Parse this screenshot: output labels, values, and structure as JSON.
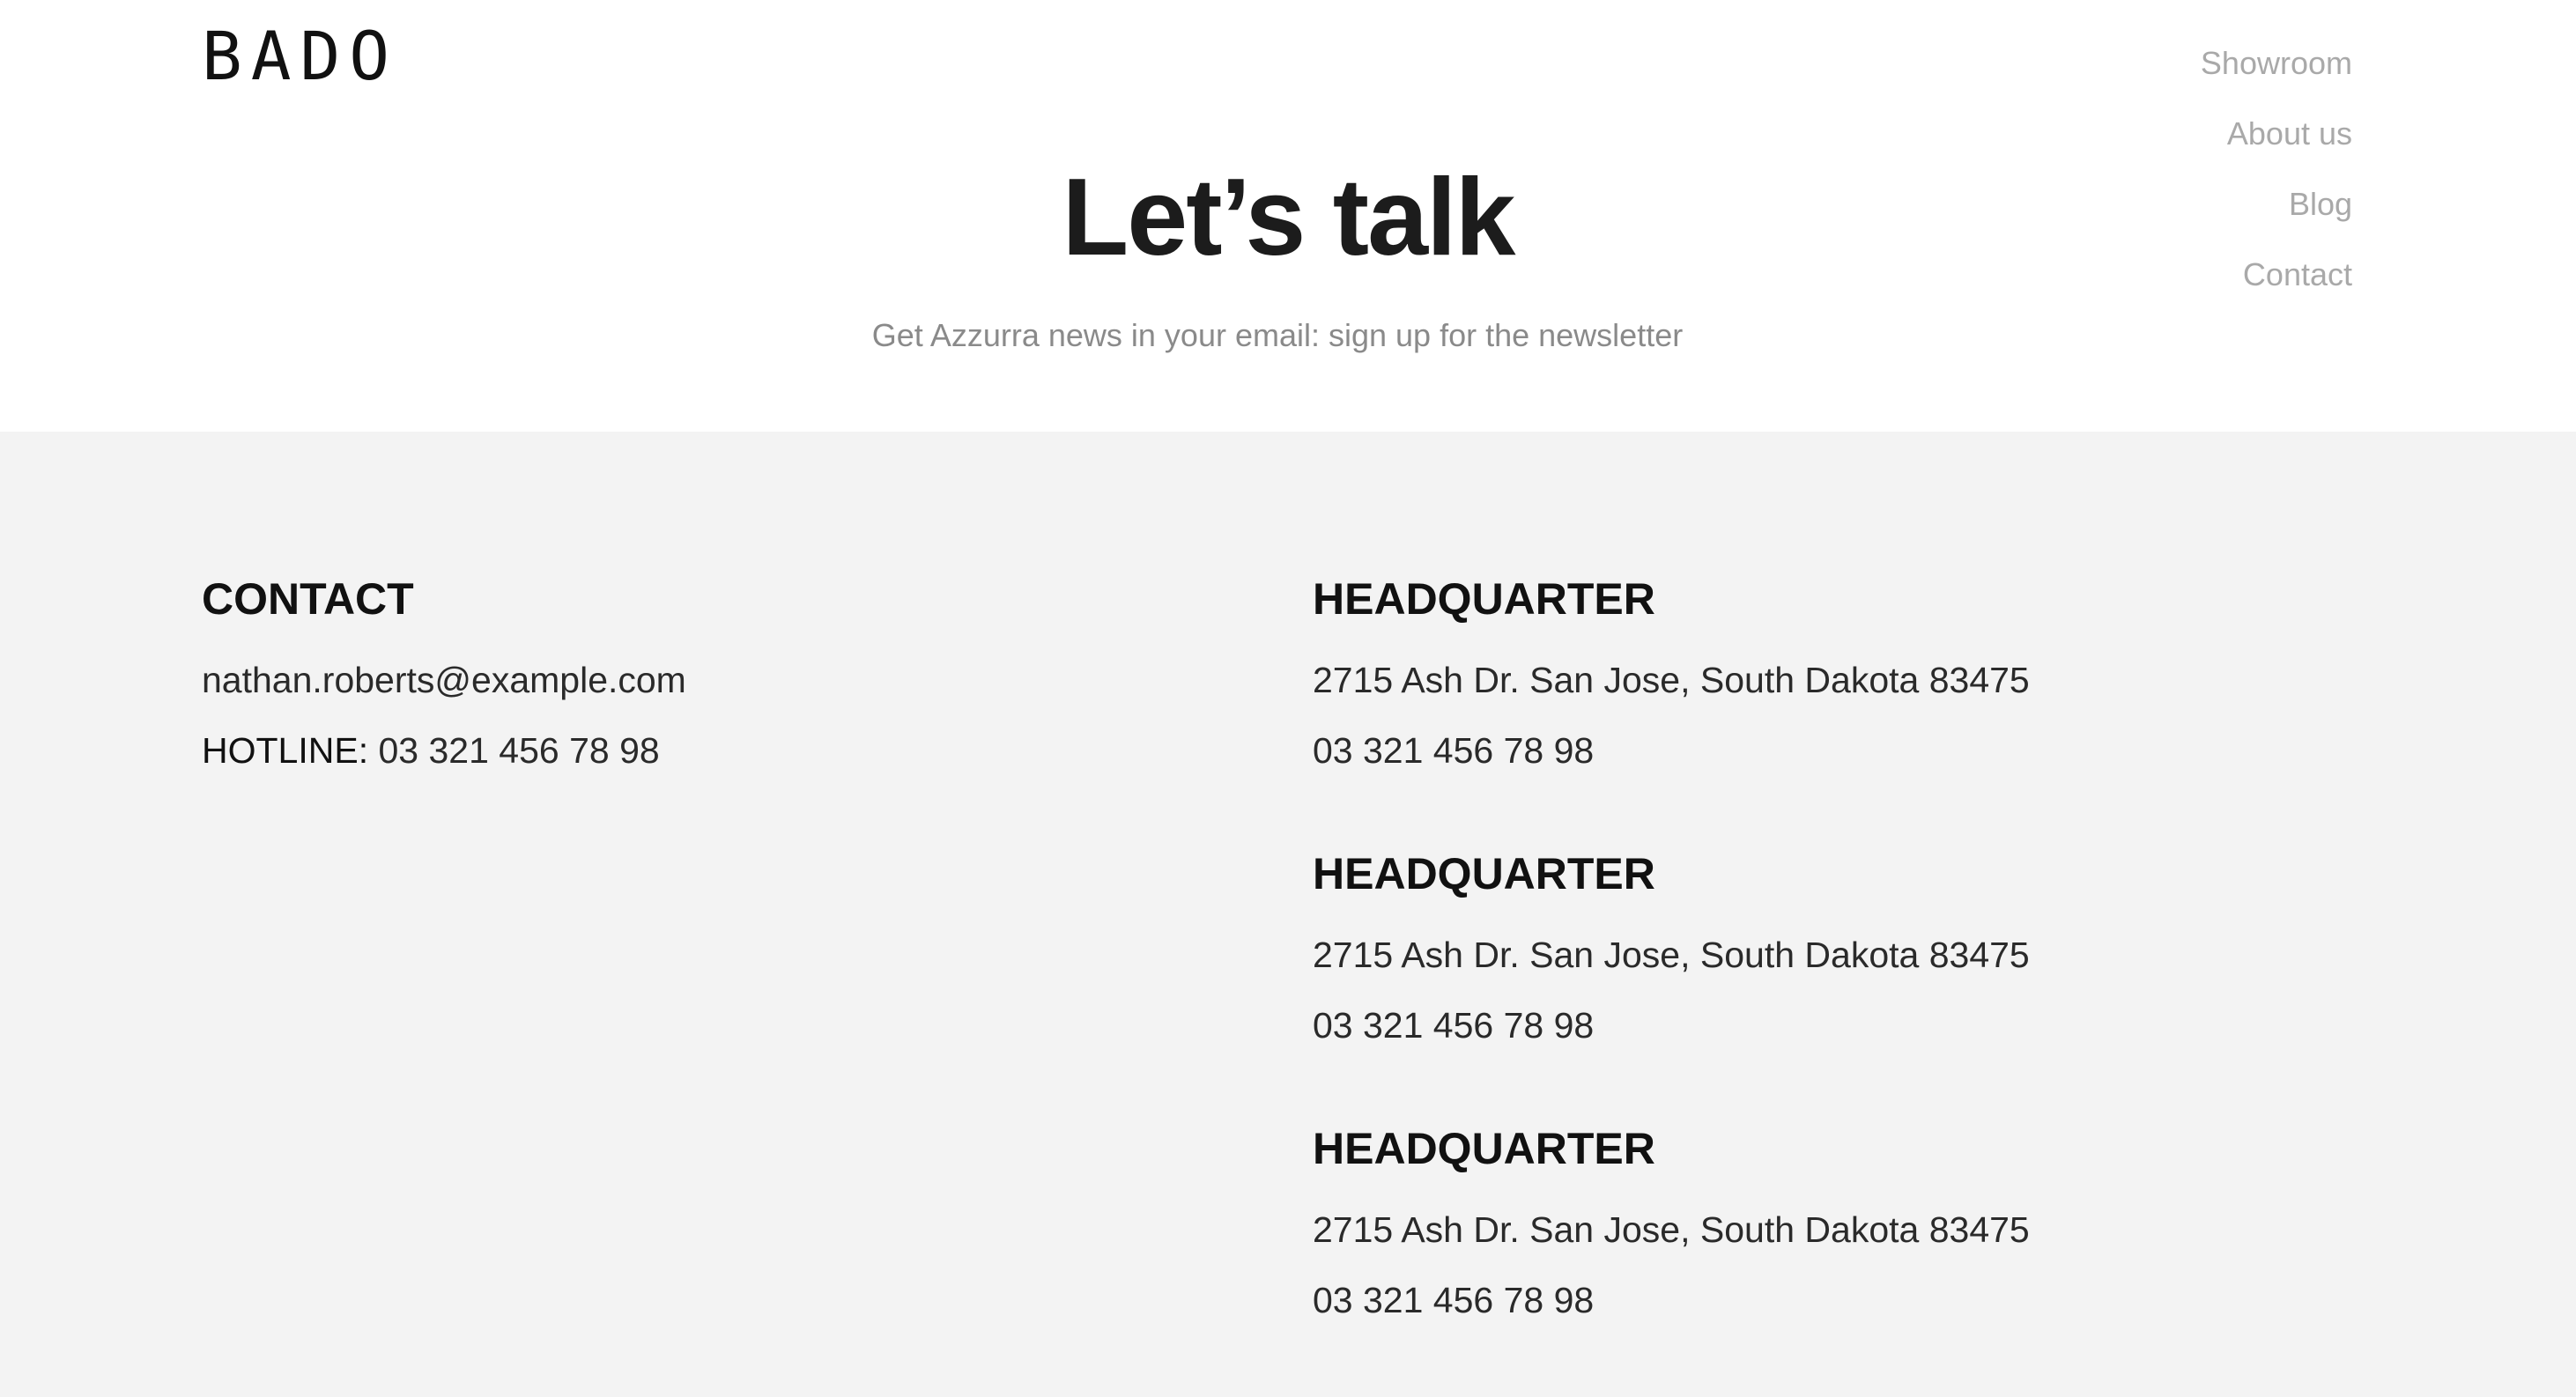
{
  "header": {
    "logo_text": "BADO",
    "nav": {
      "items": [
        {
          "label": "Showroom"
        },
        {
          "label": "About us"
        },
        {
          "label": "Blog"
        },
        {
          "label": "Contact"
        }
      ]
    },
    "title": "Let’s talk",
    "subtitle": "Get Azzurra news in your email: sign up for the newsletter"
  },
  "contact": {
    "heading": "CONTACT",
    "email": "nathan.roberts@example.com",
    "hotline_label": "HOTLINE:",
    "hotline_number": "03 321 456 78 98"
  },
  "headquarters": [
    {
      "heading": "HEADQUARTER",
      "address": "2715 Ash Dr. San Jose, South Dakota 83475",
      "phone": "03 321 456 78 98"
    },
    {
      "heading": "HEADQUARTER",
      "address": "2715 Ash Dr. San Jose, South Dakota 83475",
      "phone": "03 321 456 78 98"
    },
    {
      "heading": "HEADQUARTER",
      "address": "2715 Ash Dr. San Jose, South Dakota 83475",
      "phone": "03 321 456 78 98"
    }
  ],
  "colors": {
    "header_bg": "#ffffff",
    "footer_bg": "#f3f3f3",
    "nav_text": "#a9a9a9",
    "title_text": "#1c1c1c",
    "subtitle_text": "#8a8a8a"
  }
}
